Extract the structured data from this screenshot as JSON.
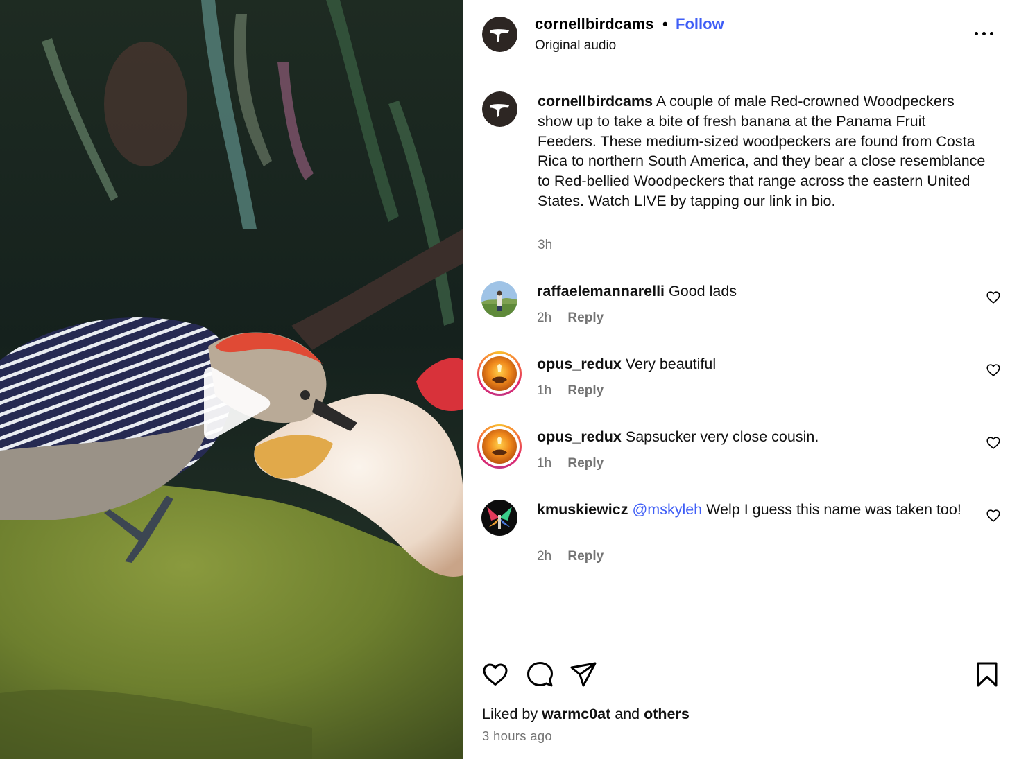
{
  "post": {
    "username": "cornellbirdcams",
    "separator": "•",
    "follow_label": "Follow",
    "audio_label": "Original audio"
  },
  "caption": {
    "username": "cornellbirdcams",
    "text": "A couple of male Red-crowned Woodpeckers show up to take a bite of fresh banana at the Panama Fruit Feeders. These medium-sized woodpeckers are found from Costa Rica to northern South America, and they bear a close resemblance to Red-bellied Woodpeckers that range across the eastern United States. Watch LIVE by tapping our link in bio.",
    "time": "3h"
  },
  "comments": [
    {
      "username": "raffaelemannarelli",
      "mention": "",
      "text": "Good lads",
      "time": "2h",
      "reply_label": "Reply"
    },
    {
      "username": "opus_redux",
      "mention": "",
      "text": "Very beautiful",
      "time": "1h",
      "reply_label": "Reply"
    },
    {
      "username": "opus_redux",
      "mention": "",
      "text": "Sapsucker very close cousin.",
      "time": "1h",
      "reply_label": "Reply"
    },
    {
      "username": "kmuskiewicz",
      "mention": "@mskyleh",
      "text": "Welp I guess this name was taken too!",
      "time": "2h",
      "reply_label": "Reply"
    }
  ],
  "likes": {
    "prefix": "Liked by",
    "user": "warmc0at",
    "joiner": "and",
    "others": "others"
  },
  "posted_ago": "3 hours ago",
  "icons": {
    "header": [
      "bird-logo-icon",
      "more-options-icon"
    ],
    "actions": [
      "heart-icon",
      "comment-icon",
      "share-icon",
      "bookmark-icon"
    ],
    "media": [
      "play-icon"
    ]
  },
  "colors": {
    "follow": "#3f5ef6",
    "mention": "#3f5ef6",
    "secondary_text": "#737373",
    "divider": "#dbdbdb"
  }
}
